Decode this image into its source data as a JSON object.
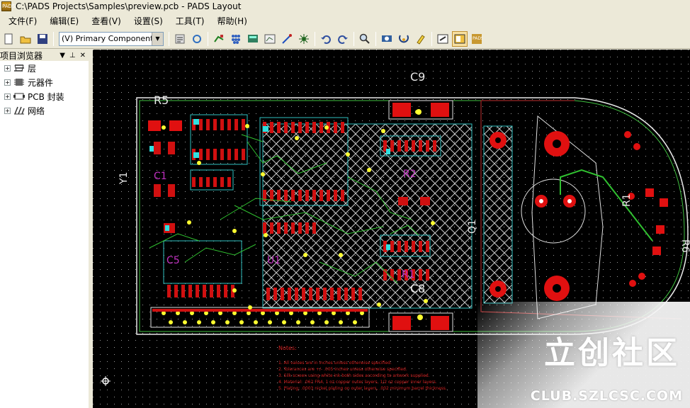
{
  "window": {
    "title": "C:\\PADS Projects\\Samples\\preview.pcb - PADS Layout",
    "icon_text": "PADS"
  },
  "menu": [
    "文件(F)",
    "编辑(E)",
    "查看(V)",
    "设置(S)",
    "工具(T)",
    "帮助(H)"
  ],
  "toolbar": {
    "layer_select": "(V) Primary Component S",
    "icons": [
      "new-icon",
      "open-icon",
      "save-icon",
      "properties-icon",
      "refresh-icon",
      "route-icon",
      "component-icon",
      "drafting-icon",
      "design-icon",
      "ecn-icon",
      "undo-icon",
      "redo-icon",
      "zoom-icon",
      "view-icon",
      "pour-icon",
      "highlight-icon",
      "session-icon",
      "output-icon",
      "pads-icon"
    ]
  },
  "project_browser": {
    "title": "项目浏览器",
    "items": [
      {
        "label": "层",
        "icon": "layers-icon"
      },
      {
        "label": "元器件",
        "icon": "component-icon"
      },
      {
        "label": "PCB 封装",
        "icon": "decal-icon"
      },
      {
        "label": "网络",
        "icon": "net-icon"
      }
    ]
  },
  "pcb": {
    "ref_labels": [
      "C9",
      "R5",
      "Y1",
      "C1",
      "R2",
      "R1",
      "C8",
      "Q1",
      "C5",
      "U1",
      "R6"
    ],
    "notes_title": "Notes:",
    "notes": [
      "1. All values are in inches unless otherwise specified.",
      "2. Tolerances are +/- .005 inches unless otherwise specified.",
      "3. Silk screen using white ink both sides according to artwork supplied.",
      "4. Material: .062 FR4, 1 oz copper outer layers, 1/2 oz copper inner layers.",
      "5. Plating: .0003 nickel plating on outer layers, .002 minimum barrel thickness."
    ],
    "colors": {
      "board": "#000000",
      "pad": "#ff0000",
      "trace": "#00cc00",
      "silk": "#ffffff",
      "via": "#ffff00",
      "refdes": "#cc00cc",
      "keepout": "#00cccc"
    }
  },
  "watermark": {
    "text": "立创社区",
    "url": "CLUB.SZLCSC.COM"
  }
}
